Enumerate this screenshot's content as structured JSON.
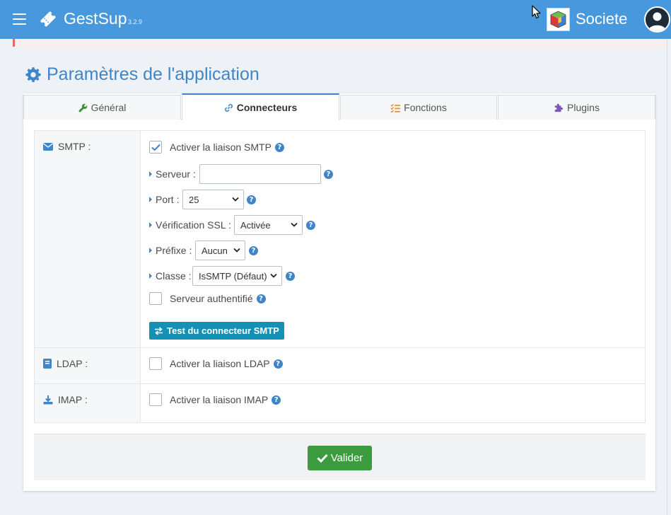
{
  "navbar": {
    "brand_name": "GestSup",
    "brand_version": "3.2.9",
    "company_name": "Societe",
    "color": "#4798dc"
  },
  "page": {
    "title": "Paramètres de l'application"
  },
  "tabs": [
    {
      "label": "Général",
      "icon": "wrench-icon",
      "active": false
    },
    {
      "label": "Connecteurs",
      "icon": "link-icon",
      "active": true
    },
    {
      "label": "Fonctions",
      "icon": "list-check-icon",
      "active": false
    },
    {
      "label": "Plugins",
      "icon": "puzzle-icon",
      "active": false
    }
  ],
  "smtp": {
    "label": "SMTP :",
    "enable_label": "Activer la liaison SMTP",
    "enable_checked": true,
    "server_label": "Serveur :",
    "server_value": "",
    "port_label": "Port :",
    "port_value": "25",
    "ssl_label": "Vérification SSL :",
    "ssl_value": "Activée",
    "prefix_label": "Préfixe :",
    "prefix_value": "Aucun",
    "class_label": "Classe :",
    "class_value": "IsSMTP (Défaut)",
    "auth_label": "Serveur authentifié",
    "auth_checked": false,
    "test_button": "Test du connecteur SMTP"
  },
  "ldap": {
    "label": "LDAP :",
    "enable_label": "Activer la liaison LDAP",
    "enable_checked": false
  },
  "imap": {
    "label": "IMAP :",
    "enable_label": "Activer la liaison IMAP",
    "enable_checked": false
  },
  "footer": {
    "validate_button": "Valider"
  },
  "colors": {
    "accent": "#3f86c8",
    "test_button": "#1591b6",
    "validate_button": "#3c9a3f"
  }
}
